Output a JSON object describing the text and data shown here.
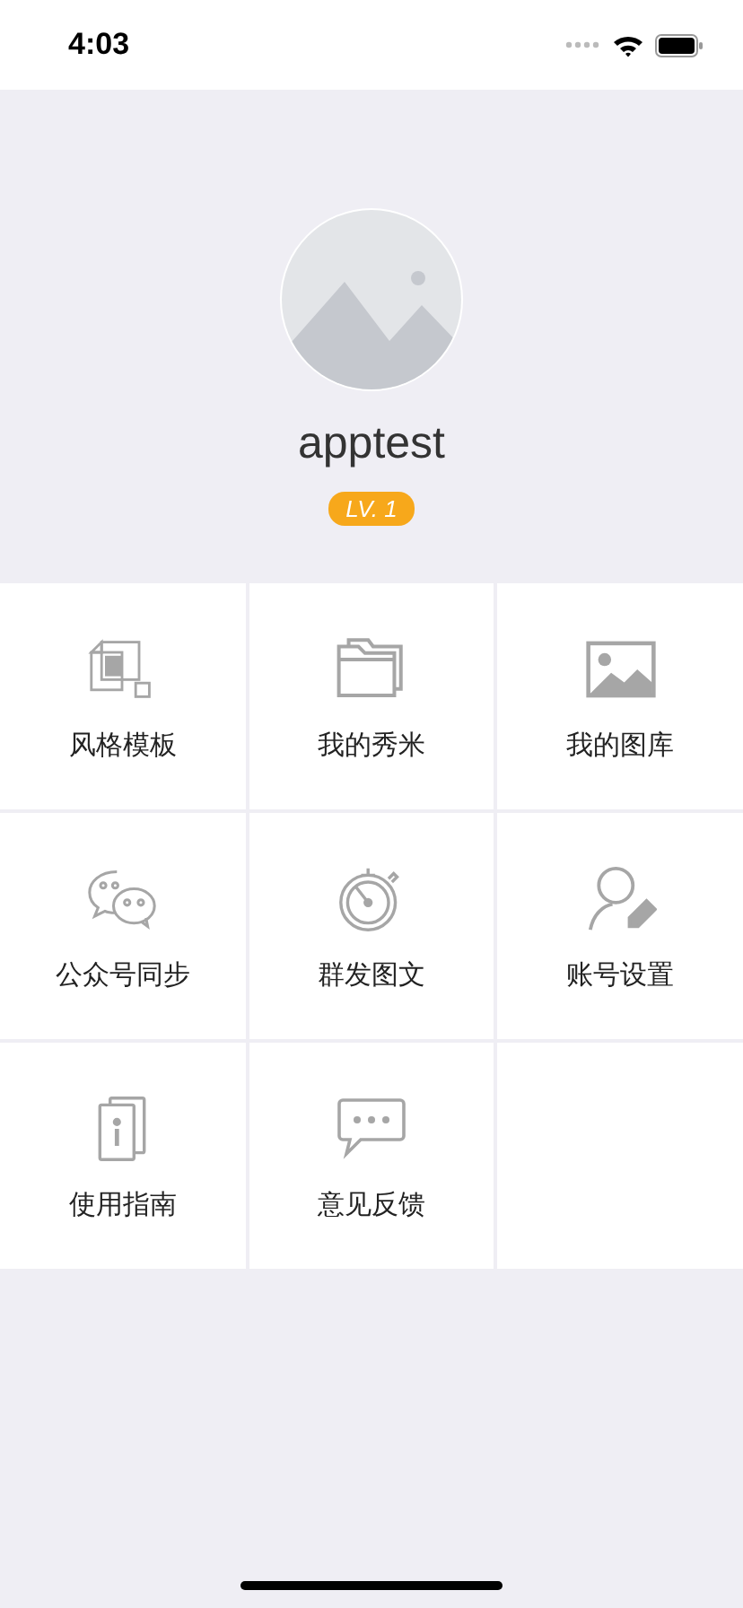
{
  "status_bar": {
    "time": "4:03"
  },
  "profile": {
    "username": "apptest",
    "level_badge": "LV. 1"
  },
  "menu": [
    {
      "label": "风格模板",
      "kind": "template"
    },
    {
      "label": "我的秀米",
      "kind": "folder"
    },
    {
      "label": "我的图库",
      "kind": "image"
    },
    {
      "label": "公众号同步",
      "kind": "chat"
    },
    {
      "label": "群发图文",
      "kind": "stopwatch"
    },
    {
      "label": "账号设置",
      "kind": "user-edit"
    },
    {
      "label": "使用指南",
      "kind": "guide"
    },
    {
      "label": "意见反馈",
      "kind": "feedback"
    }
  ]
}
